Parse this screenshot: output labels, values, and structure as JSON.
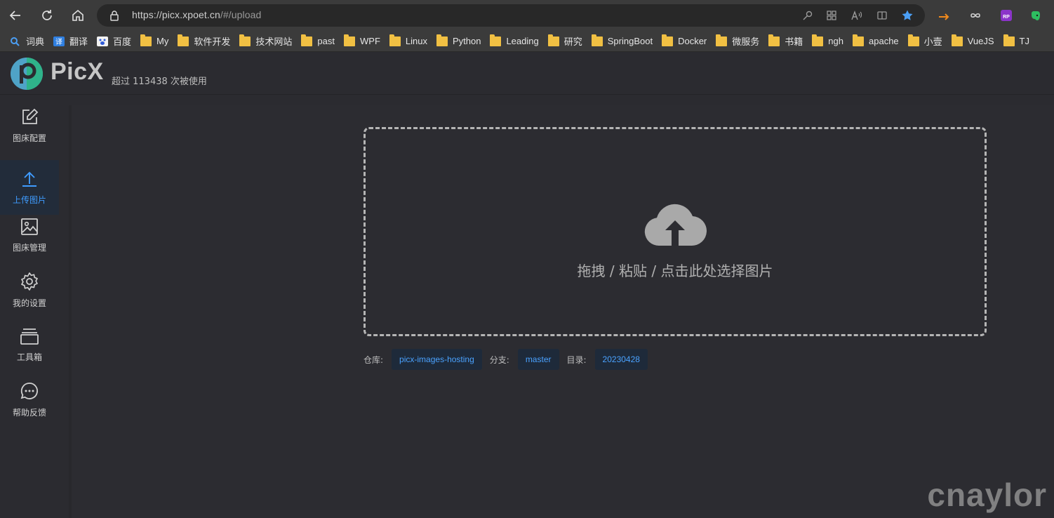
{
  "browser": {
    "url_host": "https://picx.xpoet.cn",
    "url_path": "/#/upload",
    "bookmarks": [
      "词典",
      "翻译",
      "百度",
      "My",
      "软件开发",
      "技术网站",
      "past",
      "WPF",
      "Linux",
      "Python",
      "Leading",
      "研究",
      "SpringBoot",
      "Docker",
      "微服务",
      "书籍",
      "ngh",
      "apache",
      "小壹",
      "VueJS",
      "TJ"
    ]
  },
  "header": {
    "brand": "PicX",
    "usage": "超过 113438 次被使用"
  },
  "sidebar": {
    "items": [
      {
        "label": "图床配置"
      },
      {
        "label": "上传图片"
      },
      {
        "label": "图床管理"
      },
      {
        "label": "我的设置"
      },
      {
        "label": "工具箱"
      },
      {
        "label": "帮助反馈"
      }
    ]
  },
  "upload": {
    "hint": "拖拽 / 粘贴 / 点击此处选择图片"
  },
  "meta": {
    "repo_label": "仓库:",
    "repo": "picx-images-hosting",
    "branch_label": "分支:",
    "branch": "master",
    "dir_label": "目录:",
    "dir": "20230428"
  },
  "watermark": "cnaylor",
  "colors": {
    "accent": "#3f9cff",
    "tag_bg": "#1e2a3a",
    "background": "#2b2b30"
  }
}
